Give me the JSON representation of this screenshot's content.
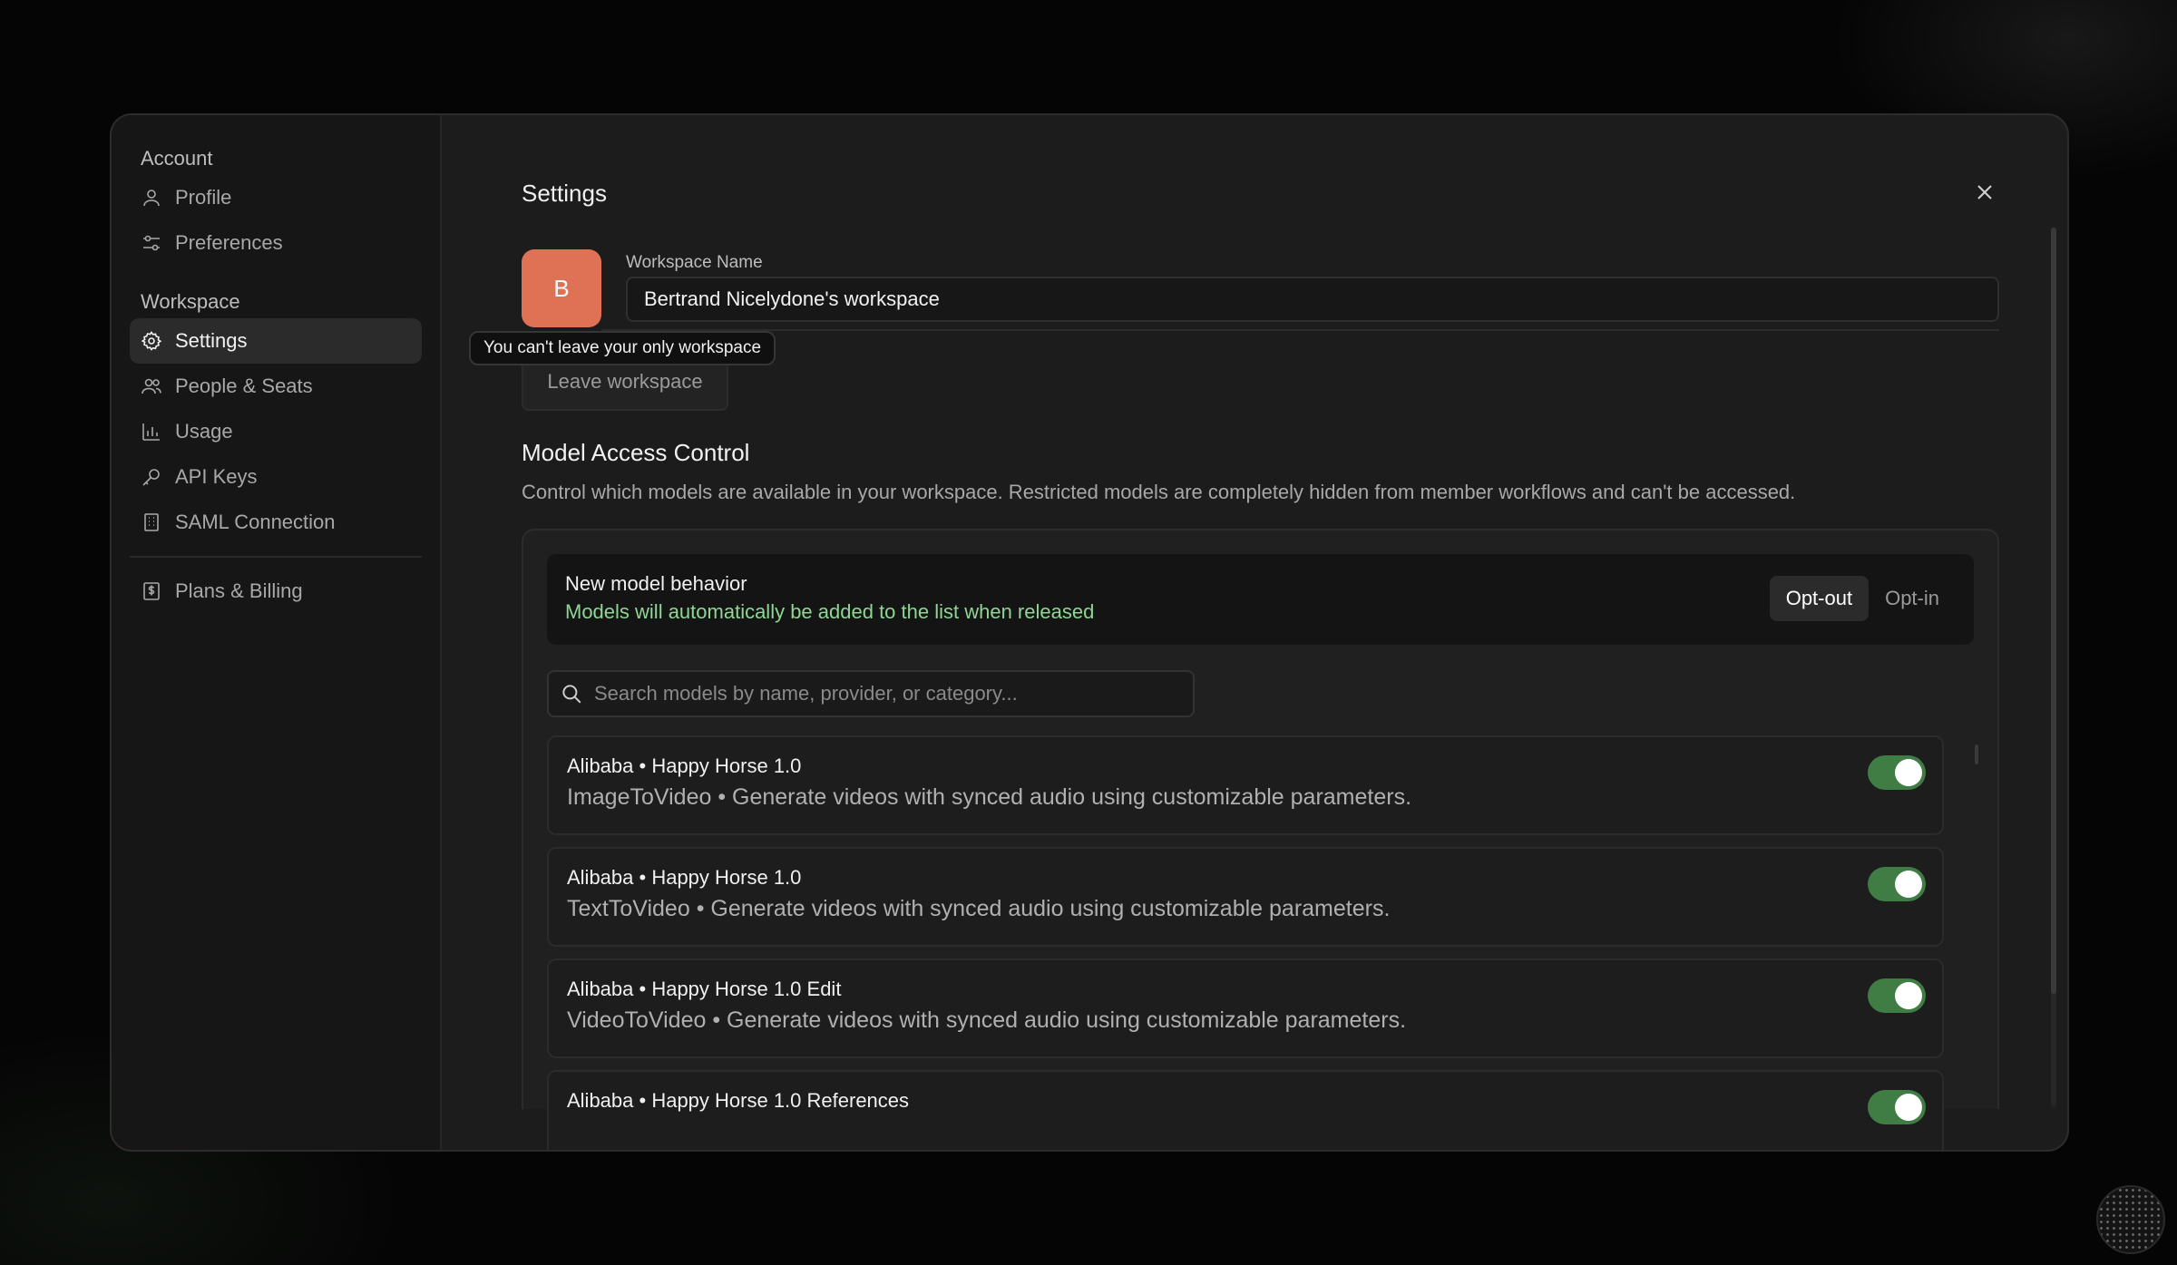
{
  "sidebar": {
    "account_title": "Account",
    "account_items": [
      {
        "label": "Profile",
        "icon": "user-icon"
      },
      {
        "label": "Preferences",
        "icon": "sliders-icon"
      }
    ],
    "workspace_title": "Workspace",
    "workspace_items": [
      {
        "label": "Settings",
        "icon": "gear-icon",
        "active": true
      },
      {
        "label": "People & Seats",
        "icon": "users-icon"
      },
      {
        "label": "Usage",
        "icon": "bar-chart-icon"
      },
      {
        "label": "API Keys",
        "icon": "key-icon"
      },
      {
        "label": "SAML Connection",
        "icon": "building-icon"
      }
    ],
    "billing_item": {
      "label": "Plans & Billing",
      "icon": "dollar-file-icon"
    }
  },
  "header": {
    "title": "Settings"
  },
  "workspace": {
    "avatar_letter": "B",
    "name_label": "Workspace Name",
    "name_value": "Bertrand Nicelydone's workspace",
    "tooltip": "You can't leave your only workspace",
    "leave_label": "Leave workspace"
  },
  "model_access": {
    "title": "Model Access Control",
    "description": "Control which models are available in your workspace. Restricted models are completely hidden from member workflows and can't be accessed.",
    "behavior_title": "New model behavior",
    "behavior_subtitle": "Models will automatically be added to the list when released",
    "opt_out_label": "Opt-out",
    "opt_in_label": "Opt-in",
    "selected_mode": "Opt-out",
    "search_placeholder": "Search models by name, provider, or category...",
    "models": [
      {
        "name": "Alibaba • Happy Horse 1.0",
        "desc": "ImageToVideo • Generate videos with synced audio using customizable parameters.",
        "enabled": true
      },
      {
        "name": "Alibaba • Happy Horse 1.0",
        "desc": "TextToVideo • Generate videos with synced audio using customizable parameters.",
        "enabled": true
      },
      {
        "name": "Alibaba • Happy Horse 1.0 Edit",
        "desc": "VideoToVideo • Generate videos with synced audio using customizable parameters.",
        "enabled": true
      },
      {
        "name": "Alibaba • Happy Horse 1.0 References",
        "desc": "",
        "enabled": true
      }
    ]
  },
  "colors": {
    "accent_avatar": "#df7155",
    "toggle_on": "#3f7d45",
    "subtitle_green": "#8fd694"
  }
}
